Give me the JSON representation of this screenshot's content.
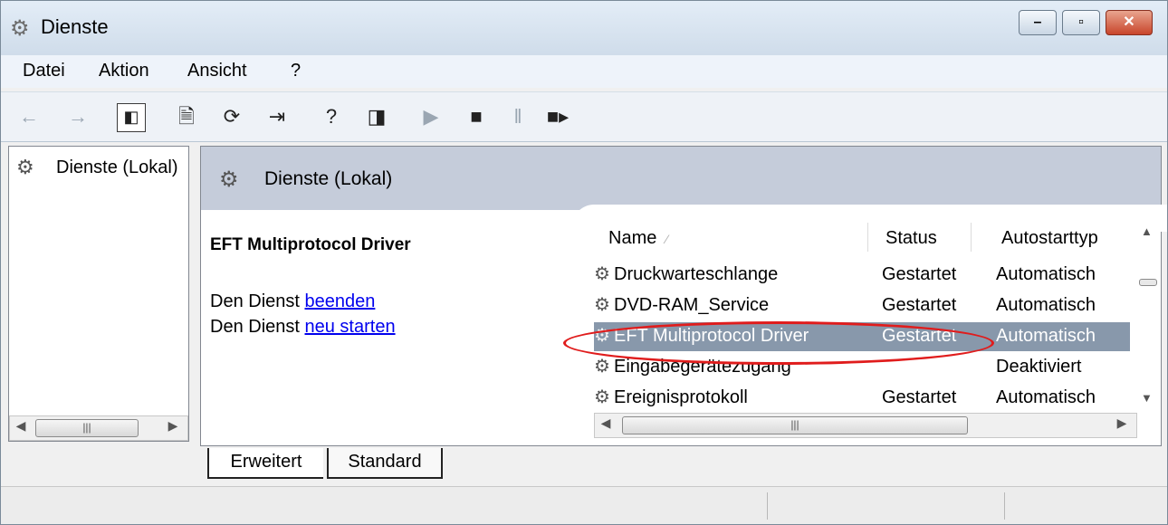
{
  "window": {
    "title": "Dienste"
  },
  "menu": {
    "items": [
      "Datei",
      "Aktion",
      "Ansicht",
      "?"
    ]
  },
  "tree": {
    "label": "Dienste (Lokal)"
  },
  "pane": {
    "header_title": "Dienste (Lokal)"
  },
  "description": {
    "title": "EFT Multiprotocol Driver",
    "line1_prefix": "Den Dienst ",
    "line1_link": "beenden",
    "line2_prefix": "Den Dienst ",
    "line2_link": "neu starten"
  },
  "list": {
    "columns": {
      "name": "Name",
      "status": "Status",
      "startup": "Autostarttyp"
    },
    "rows": [
      {
        "name": "Druckwarteschlange",
        "status": "Gestartet",
        "startup": "Automatisch"
      },
      {
        "name": "DVD-RAM_Service",
        "status": "Gestartet",
        "startup": "Automatisch"
      },
      {
        "name": "EFT Multiprotocol Driver",
        "status": "Gestartet",
        "startup": "Automatisch"
      },
      {
        "name": "Eingabegerätezugang",
        "status": "",
        "startup": "Deaktiviert"
      },
      {
        "name": "Ereignisprotokoll",
        "status": "Gestartet",
        "startup": "Automatisch"
      }
    ],
    "selected_row": "EFT Multiprotocol Driver"
  },
  "tabs": [
    "Erweitert",
    "Standard"
  ],
  "active_tab": "Erweitert",
  "icons": {
    "app": "gear-icon",
    "back": "arrow-left-icon",
    "forward": "arrow-right-icon",
    "console_tree": "show-hide-tree-icon",
    "properties": "properties-icon",
    "refresh": "refresh-icon",
    "export": "export-list-icon",
    "help": "help-icon",
    "action_pane": "show-hide-action-pane-icon",
    "start": "play-icon",
    "stop": "stop-icon",
    "pause": "pause-icon",
    "restart": "restart-icon"
  },
  "colors": {
    "selection": "#8898ab",
    "pane_header": "#c5ccda",
    "link": "#0000ee",
    "annotation": "#e01c1c"
  }
}
